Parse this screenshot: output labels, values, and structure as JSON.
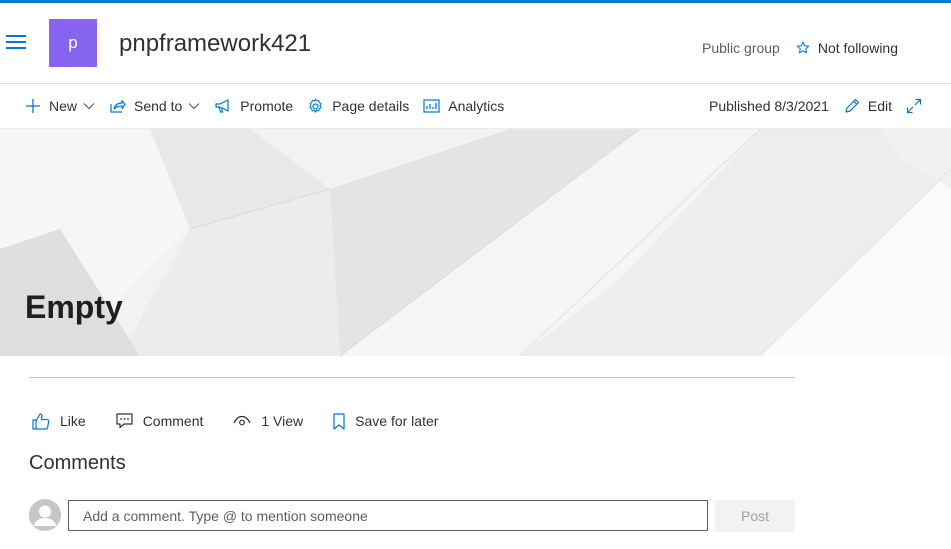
{
  "site": {
    "logo_letter": "p",
    "title": "pnpframework421",
    "group_type": "Public group",
    "follow_label": "Not following"
  },
  "commandbar": {
    "new_label": "New",
    "send_to_label": "Send to",
    "promote_label": "Promote",
    "page_details_label": "Page details",
    "analytics_label": "Analytics",
    "published_text": "Published 8/3/2021",
    "edit_label": "Edit"
  },
  "page": {
    "title": "Empty"
  },
  "social": {
    "like_label": "Like",
    "comment_label": "Comment",
    "views_label": "1 View",
    "save_label": "Save for later"
  },
  "comments": {
    "heading": "Comments",
    "placeholder": "Add a comment. Type @ to mention someone",
    "post_label": "Post"
  },
  "colors": {
    "accent": "#0078d4",
    "site_logo": "#8764f0"
  }
}
